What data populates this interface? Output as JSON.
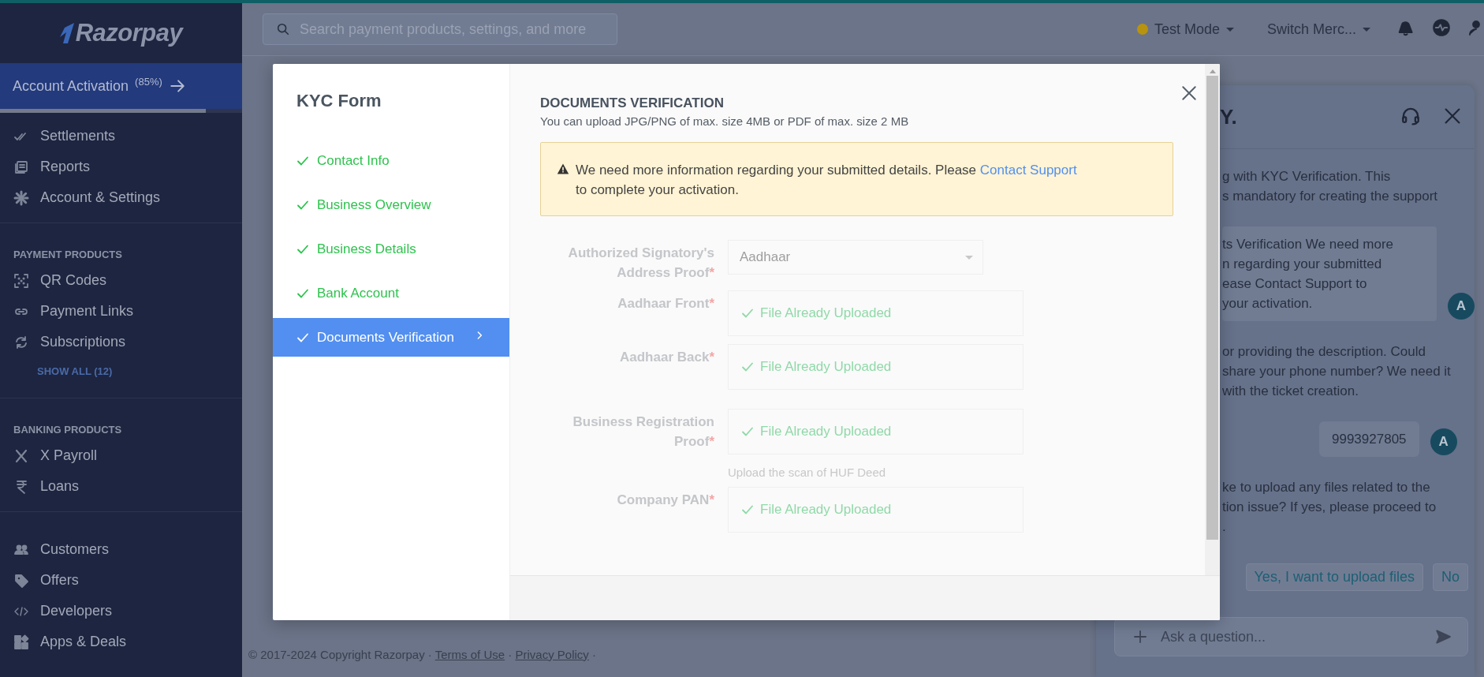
{
  "top_bar": {
    "search": {
      "placeholder": "Search payment products, settings, and more"
    },
    "mode": "Test Mode",
    "merchant": "Switch Merc..."
  },
  "sidebar": {
    "logo": "Razorpay",
    "activation": {
      "label": "Account Activation",
      "percent": "(85%)",
      "level": 0.85
    },
    "sections": [
      {
        "items": [
          {
            "label": "Settlements"
          },
          {
            "label": "Reports"
          },
          {
            "label": "Account & Settings"
          }
        ]
      },
      {
        "heading": "PAYMENT PRODUCTS",
        "items": [
          {
            "label": "QR Codes"
          },
          {
            "label": "Payment Links"
          },
          {
            "label": "Subscriptions"
          }
        ],
        "link": "SHOW ALL (12)"
      },
      {
        "heading": "BANKING PRODUCTS",
        "items": [
          {
            "label": "X Payroll"
          },
          {
            "label": "Loans"
          }
        ]
      },
      {
        "items": [
          {
            "label": "Customers"
          },
          {
            "label": "Offers"
          },
          {
            "label": "Developers"
          },
          {
            "label": "Apps & Deals"
          }
        ]
      }
    ]
  },
  "footer": {
    "copyright": "© 2017-2024 Copyright Razorpay",
    "separator": "·",
    "links": [
      "Terms of Use",
      "Privacy Policy"
    ]
  },
  "chat": {
    "title": "Y.",
    "messages": [
      {
        "kind": "text",
        "lines": [
          "g with KYC Verification. This",
          "s mandatory for creating the support"
        ]
      },
      {
        "kind": "bubble",
        "lines": [
          "ts Verification We need more",
          "n regarding your submitted",
          "ease Contact Support to",
          "your activation."
        ],
        "avatar": "A"
      },
      {
        "kind": "text",
        "lines": [
          "or providing the description. Could",
          "share your phone number? We need it",
          "with the ticket creation."
        ]
      },
      {
        "kind": "reply",
        "lines": [
          "9993927805"
        ],
        "avatar": "A"
      },
      {
        "kind": "text",
        "lines": [
          "ke to upload any files related to the",
          "tion issue? If yes, please proceed to",
          "."
        ]
      }
    ],
    "quick_replies": [
      "Yes, I want to upload files",
      "No"
    ],
    "input": {
      "placeholder": "Ask a question..."
    }
  },
  "modal": {
    "title": "KYC Form",
    "steps": [
      {
        "label": "Contact Info",
        "done": true,
        "selected": false
      },
      {
        "label": "Business Overview",
        "done": true,
        "selected": false
      },
      {
        "label": "Business Details",
        "done": true,
        "selected": false
      },
      {
        "label": "Bank Account",
        "done": true,
        "selected": false
      },
      {
        "label": "Documents Verification",
        "done": true,
        "selected": true
      }
    ],
    "section_title": "DOCUMENTS VERIFICATION",
    "section_subtitle": "You can upload JPG/PNG of max. size 4MB or PDF of max. size 2 MB",
    "alert": {
      "text": "We need more information regarding your submitted details. Please",
      "link": "Contact Support",
      "text_after": "to complete your activation."
    },
    "fields": [
      {
        "kind": "select",
        "label": "Authorized Signatory's Address Proof",
        "required_mark": "*",
        "value": "Aadhaar"
      },
      {
        "kind": "upload",
        "label": "Aadhaar Front",
        "required_mark": "*",
        "value": "File Already Uploaded"
      },
      {
        "kind": "upload",
        "label": "Aadhaar Back",
        "required_mark": "*",
        "value": "File Already Uploaded"
      },
      {
        "kind": "upload",
        "label": "Business Registration Proof",
        "required_mark": "*",
        "value": "File Already Uploaded",
        "hint": "Upload the scan of HUF Deed"
      },
      {
        "kind": "upload",
        "label": "Company PAN",
        "required_mark": "*",
        "value": "File Already Uploaded"
      }
    ]
  }
}
